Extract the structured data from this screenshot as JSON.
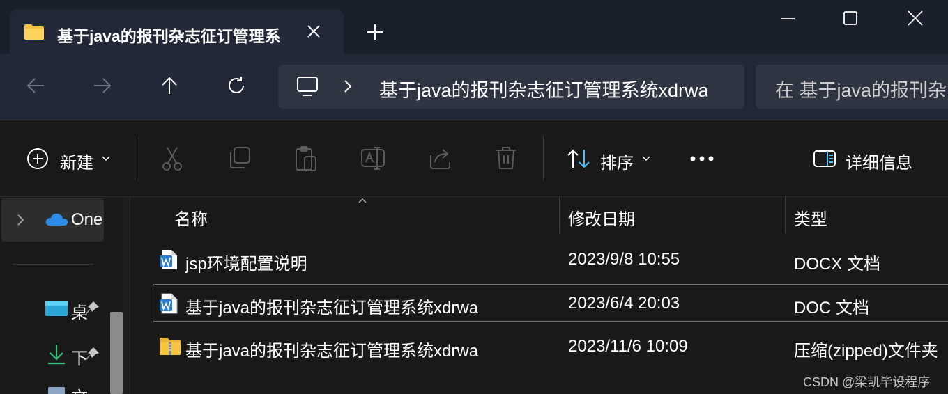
{
  "tab": {
    "title": "基于java的报刊杂志征订管理系"
  },
  "address": {
    "path": "基于java的报刊杂志征订管理系统xdrwa"
  },
  "search": {
    "placeholder": "在 基于java的报刊杂"
  },
  "toolbar": {
    "new_label": "新建",
    "sort_label": "排序",
    "details_label": "详细信息"
  },
  "sidebar": {
    "onedrive_label": "One",
    "items": [
      {
        "label": "桌",
        "icon": "desktop-icon"
      },
      {
        "label": "下",
        "icon": "download-icon"
      },
      {
        "label": "文",
        "icon": "documents-icon"
      }
    ]
  },
  "columns": {
    "name": "名称",
    "modified": "修改日期",
    "type": "类型"
  },
  "files": [
    {
      "name": "jsp环境配置说明",
      "date": "2023/9/8 10:55",
      "type": "DOCX 文档",
      "icon": "word-docx-icon"
    },
    {
      "name": "基于java的报刊杂志征订管理系统xdrwa",
      "date": "2023/6/4 20:03",
      "type": "DOC 文档",
      "icon": "word-doc-icon"
    },
    {
      "name": "基于java的报刊杂志征订管理系统xdrwa",
      "date": "2023/11/6 10:09",
      "type": "压缩(zipped)文件夹",
      "icon": "zip-folder-icon"
    }
  ],
  "watermark": "CSDN @梁凯毕设程序",
  "colors": {
    "accent": "#4cc2ff",
    "folder": "#f5c542",
    "word": "#2b7cd3"
  }
}
